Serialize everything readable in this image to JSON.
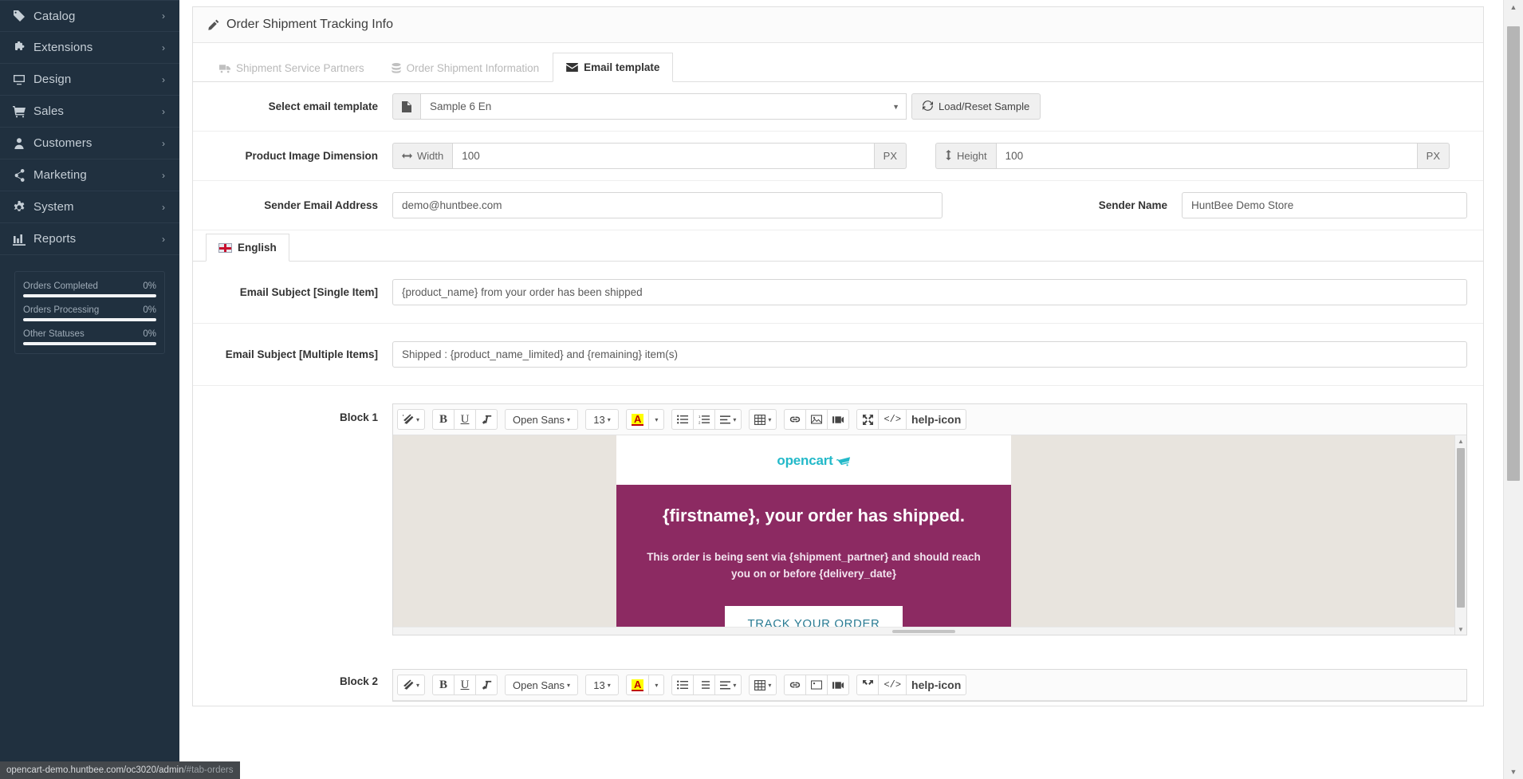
{
  "sidebar": {
    "items": [
      {
        "label": "Catalog",
        "icon": "tag-icon"
      },
      {
        "label": "Extensions",
        "icon": "puzzle-icon"
      },
      {
        "label": "Design",
        "icon": "monitor-icon"
      },
      {
        "label": "Sales",
        "icon": "cart-icon"
      },
      {
        "label": "Customers",
        "icon": "user-icon"
      },
      {
        "label": "Marketing",
        "icon": "share-icon"
      },
      {
        "label": "System",
        "icon": "gear-icon"
      },
      {
        "label": "Reports",
        "icon": "bar-chart-icon"
      }
    ],
    "caret": "›",
    "stats": [
      {
        "label": "Orders Completed",
        "value": "0%",
        "percent": 100
      },
      {
        "label": "Orders Processing",
        "value": "0%",
        "percent": 100
      },
      {
        "label": "Other Statuses",
        "value": "0%",
        "percent": 100
      }
    ]
  },
  "panel": {
    "title": "Order Shipment Tracking Info",
    "title_icon": "pencil-icon"
  },
  "tabs": [
    {
      "label": "Shipment Service Partners",
      "icon": "truck-icon",
      "active": false
    },
    {
      "label": "Order Shipment Information",
      "icon": "database-icon",
      "active": false
    },
    {
      "label": "Email template",
      "icon": "envelope-icon",
      "active": true
    }
  ],
  "form": {
    "select_template": {
      "label": "Select email template",
      "icon": "file-icon",
      "value": "Sample 6 En",
      "caret": "▼",
      "button_label": "Load/Reset Sample",
      "button_icon": "refresh-icon"
    },
    "image_dimension": {
      "label": "Product Image Dimension",
      "width_addon": "Width",
      "width_icon": "arrows-h-icon",
      "width_value": "100",
      "width_unit": "PX",
      "height_addon": "Height",
      "height_icon": "arrows-v-icon",
      "height_value": "100",
      "height_unit": "PX"
    },
    "sender_email": {
      "label": "Sender Email Address",
      "value": "demo@huntbee.com"
    },
    "sender_name": {
      "label": "Sender Name",
      "value": "HuntBee Demo Store"
    },
    "language_tab": {
      "label": "English",
      "flag": "uk-flag-icon"
    },
    "subject_single": {
      "label": "Email Subject [Single Item]",
      "value": "{product_name} from your order has been shipped"
    },
    "subject_multiple": {
      "label": "Email Subject [Multiple Items]",
      "value": "Shipped : {product_name_limited} and {remaining} item(s)"
    },
    "block1_label": "Block 1",
    "block2_label": "Block 2"
  },
  "editor": {
    "toolbar": {
      "style_icon": "magic-wand-icon",
      "bold": "B",
      "underline": "U",
      "eraser_icon": "remove-format-icon",
      "font_name": "Open Sans",
      "font_size": "13",
      "fore_color": "A",
      "unordered_list_icon": "bullet-list-icon",
      "ordered_list_icon": "numbered-list-icon",
      "align_icon": "align-left-icon",
      "table_icon": "table-icon",
      "link_icon": "link-icon",
      "picture_icon": "image-icon",
      "video_icon": "video-icon",
      "fullscreen_icon": "fullscreen-icon",
      "codeview_icon": "code-view-icon",
      "help_icon": "help-icon",
      "caret": "▾"
    },
    "email_preview": {
      "logo_text": "opencart",
      "logo_icon": "opencart-cart-icon",
      "heading": "{firstname}, your order has shipped.",
      "paragraph": "This order is being sent via {shipment_partner} and should reach you on or before {delivery_date}",
      "button_label": "TRACK YOUR ORDER",
      "banner_color": "#8c2a62",
      "logo_color": "#23b9c9",
      "canvas_color": "#e8e4de",
      "button_text_color": "#2a7b93"
    }
  },
  "status_bar": {
    "url": "opencart-demo.huntbee.com/oc3020/admin",
    "fragment": "/#tab-orders"
  },
  "scrollbar": {
    "up_arrow": "▲",
    "down_arrow": "▼"
  }
}
